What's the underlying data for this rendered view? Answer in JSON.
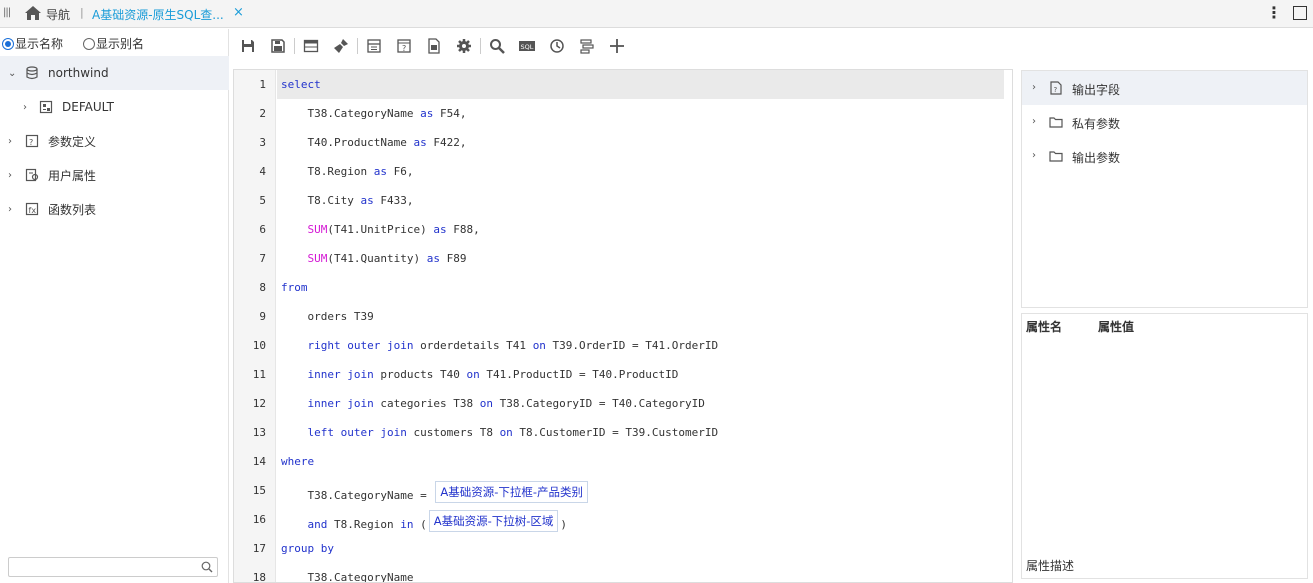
{
  "topbar": {
    "nav_label": "导航",
    "tab_label": "A基础资源-原生SQL查...",
    "close_glyph": "×"
  },
  "left": {
    "radio_show_name": "显示名称",
    "radio_show_alias": "显示别名",
    "tree": [
      {
        "label": "northwind",
        "icon": "database-icon",
        "level": 0,
        "expanded": true,
        "selected": true
      },
      {
        "label": "DEFAULT",
        "icon": "schema-icon",
        "level": 1,
        "expanded": false
      },
      {
        "label": "参数定义",
        "icon": "param-def-icon",
        "level": 0,
        "expanded": false
      },
      {
        "label": "用户属性",
        "icon": "user-attr-icon",
        "level": 0,
        "expanded": false
      },
      {
        "label": "函数列表",
        "icon": "function-list-icon",
        "level": 0,
        "expanded": false
      }
    ],
    "search_placeholder": ""
  },
  "toolbar": {
    "icons": [
      "save-icon",
      "save-as-icon",
      "table-icon",
      "clear-brush-icon",
      "layout-icon",
      "help-doc-icon",
      "export-icon",
      "settings-gear-icon",
      "search-icon",
      "sql-icon",
      "history-clock-icon",
      "format-icon",
      "add-plus-icon"
    ]
  },
  "editor": {
    "lines": [
      {
        "n": "1",
        "parts": [
          {
            "t": "select",
            "c": "kw"
          }
        ]
      },
      {
        "n": "2",
        "parts": [
          {
            "t": "    T38.CategoryName "
          },
          {
            "t": "as",
            "c": "kw"
          },
          {
            "t": " F54,"
          }
        ]
      },
      {
        "n": "3",
        "parts": [
          {
            "t": "    T40.ProductName "
          },
          {
            "t": "as",
            "c": "kw"
          },
          {
            "t": " F422,"
          }
        ]
      },
      {
        "n": "4",
        "parts": [
          {
            "t": "    T8.Region "
          },
          {
            "t": "as",
            "c": "kw"
          },
          {
            "t": " F6,"
          }
        ]
      },
      {
        "n": "5",
        "parts": [
          {
            "t": "    T8.City "
          },
          {
            "t": "as",
            "c": "kw"
          },
          {
            "t": " F433,"
          }
        ]
      },
      {
        "n": "6",
        "parts": [
          {
            "t": "    "
          },
          {
            "t": "SUM",
            "c": "fn"
          },
          {
            "t": "(T41.UnitPrice) "
          },
          {
            "t": "as",
            "c": "kw"
          },
          {
            "t": " F88,"
          }
        ]
      },
      {
        "n": "7",
        "parts": [
          {
            "t": "    "
          },
          {
            "t": "SUM",
            "c": "fn"
          },
          {
            "t": "(T41.Quantity) "
          },
          {
            "t": "as",
            "c": "kw"
          },
          {
            "t": " F89"
          }
        ]
      },
      {
        "n": "8",
        "parts": [
          {
            "t": "from",
            "c": "kw"
          }
        ]
      },
      {
        "n": "9",
        "parts": [
          {
            "t": "    orders T39"
          }
        ]
      },
      {
        "n": "10",
        "parts": [
          {
            "t": "    "
          },
          {
            "t": "right outer join",
            "c": "kw"
          },
          {
            "t": " orderdetails T41 "
          },
          {
            "t": "on",
            "c": "kw"
          },
          {
            "t": " T39.OrderID = T41.OrderID"
          }
        ]
      },
      {
        "n": "11",
        "parts": [
          {
            "t": "    "
          },
          {
            "t": "inner join",
            "c": "kw"
          },
          {
            "t": " products T40 "
          },
          {
            "t": "on",
            "c": "kw"
          },
          {
            "t": " T41.ProductID = T40.ProductID"
          }
        ]
      },
      {
        "n": "12",
        "parts": [
          {
            "t": "    "
          },
          {
            "t": "inner join",
            "c": "kw"
          },
          {
            "t": " categories T38 "
          },
          {
            "t": "on",
            "c": "kw"
          },
          {
            "t": " T38.CategoryID = T40.CategoryID"
          }
        ]
      },
      {
        "n": "13",
        "parts": [
          {
            "t": "    "
          },
          {
            "t": "left outer join",
            "c": "kw"
          },
          {
            "t": " customers T8 "
          },
          {
            "t": "on",
            "c": "kw"
          },
          {
            "t": " T8.CustomerID = T39.CustomerID"
          }
        ]
      },
      {
        "n": "14",
        "parts": [
          {
            "t": "where",
            "c": "kw"
          }
        ]
      },
      {
        "n": "15",
        "parts": [
          {
            "t": "    T38.CategoryName = "
          },
          {
            "t": "A基础资源-下拉框-产品类别",
            "c": "param"
          }
        ]
      },
      {
        "n": "16",
        "parts": [
          {
            "t": "    "
          },
          {
            "t": "and",
            "c": "kw"
          },
          {
            "t": " T8.Region "
          },
          {
            "t": "in",
            "c": "kw"
          },
          {
            "t": " ("
          },
          {
            "t": "A基础资源-下拉树-区域",
            "c": "param"
          },
          {
            "t": ")"
          }
        ]
      },
      {
        "n": "17",
        "parts": [
          {
            "t": "group by",
            "c": "kw"
          }
        ]
      },
      {
        "n": "18",
        "parts": [
          {
            "t": "    T38.CategoryName"
          }
        ]
      }
    ]
  },
  "right": {
    "tree": [
      {
        "label": "输出字段",
        "icon": "output-field-icon",
        "selected": true
      },
      {
        "label": "私有参数",
        "icon": "folder-icon",
        "selected": false
      },
      {
        "label": "输出参数",
        "icon": "folder-icon",
        "selected": false
      }
    ],
    "prop_name_header": "属性名",
    "prop_value_header": "属性值",
    "prop_desc_label": "属性描述"
  },
  "colors": {
    "accent": "#1a9cd8",
    "keyword": "#2233cc",
    "function": "#d418d4"
  }
}
